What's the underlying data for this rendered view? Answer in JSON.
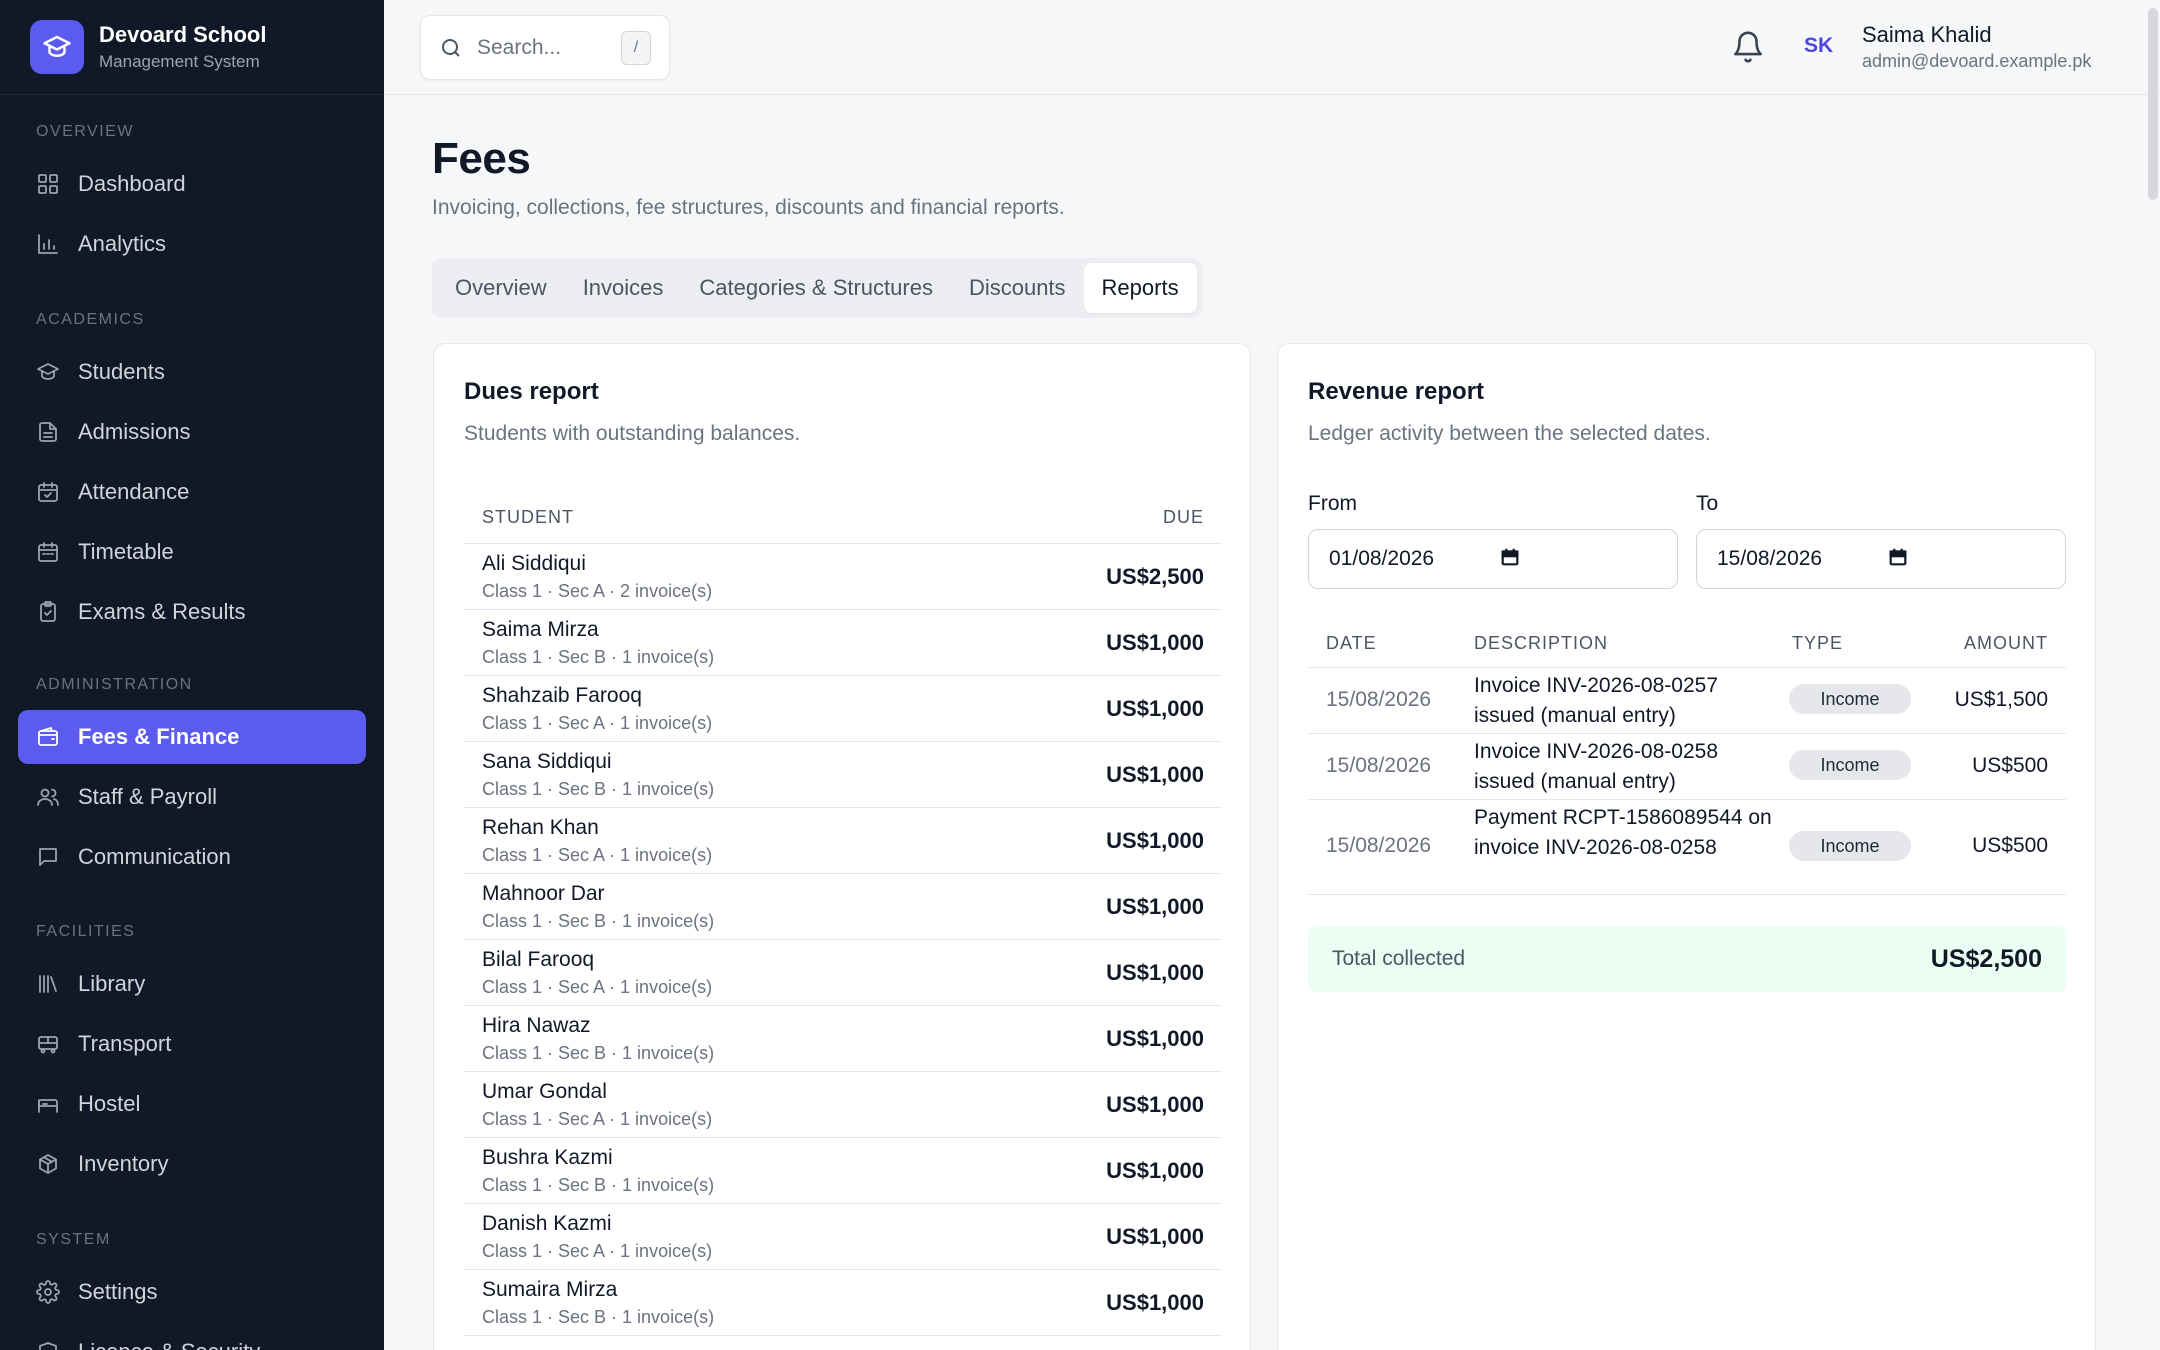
{
  "brand": {
    "title": "Devoard School",
    "subtitle": "Management System"
  },
  "sidebar": {
    "sections": [
      {
        "label": "Overview",
        "items": [
          {
            "label": "Dashboard",
            "icon": "grid-icon"
          },
          {
            "label": "Analytics",
            "icon": "bar-chart-icon"
          }
        ]
      },
      {
        "label": "Academics",
        "items": [
          {
            "label": "Students",
            "icon": "graduation-cap-icon"
          },
          {
            "label": "Admissions",
            "icon": "document-icon"
          },
          {
            "label": "Attendance",
            "icon": "calendar-check-icon"
          },
          {
            "label": "Timetable",
            "icon": "calendar-icon"
          },
          {
            "label": "Exams & Results",
            "icon": "clipboard-icon"
          }
        ]
      },
      {
        "label": "Administration",
        "items": [
          {
            "label": "Fees & Finance",
            "icon": "wallet-icon",
            "active": true
          },
          {
            "label": "Staff & Payroll",
            "icon": "users-icon"
          },
          {
            "label": "Communication",
            "icon": "message-icon"
          }
        ]
      },
      {
        "label": "Facilities",
        "items": [
          {
            "label": "Library",
            "icon": "library-icon"
          },
          {
            "label": "Transport",
            "icon": "bus-icon"
          },
          {
            "label": "Hostel",
            "icon": "bed-icon"
          },
          {
            "label": "Inventory",
            "icon": "package-icon"
          }
        ]
      },
      {
        "label": "System",
        "items": [
          {
            "label": "Settings",
            "icon": "gear-icon"
          },
          {
            "label": "Licence & Security",
            "icon": "shield-icon"
          }
        ]
      }
    ]
  },
  "search": {
    "placeholder": "Search...",
    "shortcut": "/"
  },
  "user": {
    "initials": "SK",
    "name": "Saima Khalid",
    "email": "admin@devoard.example.pk"
  },
  "page": {
    "title": "Fees",
    "subtitle": "Invoicing, collections, fee structures, discounts and financial reports."
  },
  "tabs": [
    {
      "label": "Overview"
    },
    {
      "label": "Invoices"
    },
    {
      "label": "Categories & Structures"
    },
    {
      "label": "Discounts"
    },
    {
      "label": "Reports",
      "active": true
    }
  ],
  "dues": {
    "title": "Dues report",
    "description": "Students with outstanding balances.",
    "col_student": "STUDENT",
    "col_due": "DUE",
    "rows": [
      {
        "name": "Ali Siddiqui",
        "meta": "Class 1 · Sec A · 2 invoice(s)",
        "due": "US$2,500"
      },
      {
        "name": "Saima Mirza",
        "meta": "Class 1 · Sec B · 1 invoice(s)",
        "due": "US$1,000"
      },
      {
        "name": "Shahzaib Farooq",
        "meta": "Class 1 · Sec A · 1 invoice(s)",
        "due": "US$1,000"
      },
      {
        "name": "Sana Siddiqui",
        "meta": "Class 1 · Sec B · 1 invoice(s)",
        "due": "US$1,000"
      },
      {
        "name": "Rehan Khan",
        "meta": "Class 1 · Sec A · 1 invoice(s)",
        "due": "US$1,000"
      },
      {
        "name": "Mahnoor Dar",
        "meta": "Class 1 · Sec B · 1 invoice(s)",
        "due": "US$1,000"
      },
      {
        "name": "Bilal Farooq",
        "meta": "Class 1 · Sec A · 1 invoice(s)",
        "due": "US$1,000"
      },
      {
        "name": "Hira Nawaz",
        "meta": "Class 1 · Sec B · 1 invoice(s)",
        "due": "US$1,000"
      },
      {
        "name": "Umar Gondal",
        "meta": "Class 1 · Sec A · 1 invoice(s)",
        "due": "US$1,000"
      },
      {
        "name": "Bushra Kazmi",
        "meta": "Class 1 · Sec B · 1 invoice(s)",
        "due": "US$1,000"
      },
      {
        "name": "Danish Kazmi",
        "meta": "Class 1 · Sec A · 1 invoice(s)",
        "due": "US$1,000"
      },
      {
        "name": "Sumaira Mirza",
        "meta": "Class 1 · Sec B · 1 invoice(s)",
        "due": "US$1,000"
      }
    ]
  },
  "revenue": {
    "title": "Revenue report",
    "description": "Ledger activity between the selected dates.",
    "from_label": "From",
    "from_value": "01/08/2026",
    "to_label": "To",
    "to_value": "15/08/2026",
    "col_date": "DATE",
    "col_description": "DESCRIPTION",
    "col_type": "TYPE",
    "col_amount": "AMOUNT",
    "rows": [
      {
        "date": "15/08/2026",
        "description": "Invoice INV-2026-08-0257 issued (manual entry)",
        "type": "Income",
        "amount": "US$1,500"
      },
      {
        "date": "15/08/2026",
        "description": "Invoice INV-2026-08-0258 issued (manual entry)",
        "type": "Income",
        "amount": "US$500"
      },
      {
        "date": "15/08/2026",
        "description": "Payment RCPT-1586089544 on invoice INV-2026-08-0258",
        "type": "Income",
        "amount": "US$500"
      }
    ],
    "total_label": "Total collected",
    "total_value": "US$2,500"
  },
  "colors": {
    "accent": "#5b5bf0",
    "sidebar_bg": "#111827",
    "total_bg": "#ecfdf3"
  }
}
